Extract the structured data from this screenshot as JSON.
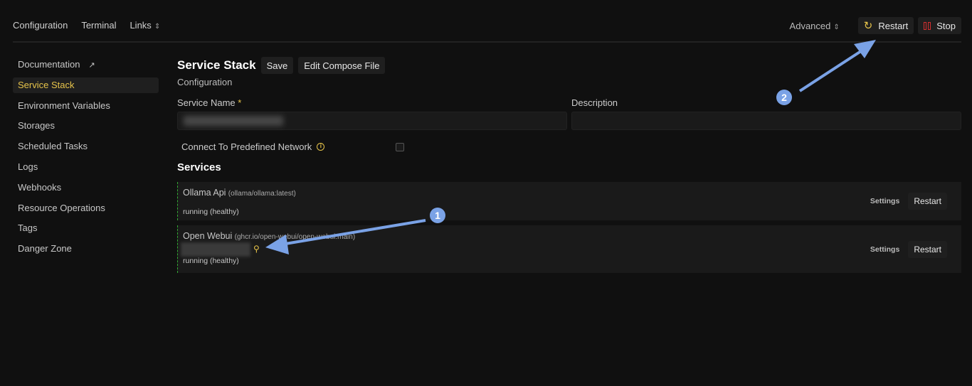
{
  "topnav": {
    "items": [
      "Configuration",
      "Terminal",
      "Links"
    ],
    "advanced": "Advanced",
    "restart": "Restart",
    "stop": "Stop"
  },
  "sidebar": {
    "items": [
      "Documentation",
      "Service Stack",
      "Environment Variables",
      "Storages",
      "Scheduled Tasks",
      "Logs",
      "Webhooks",
      "Resource Operations",
      "Tags",
      "Danger Zone"
    ]
  },
  "main": {
    "title": "Service Stack",
    "save": "Save",
    "edit_compose": "Edit Compose File",
    "subtitle": "Configuration",
    "service_name_label": "Service Name",
    "required": "*",
    "description_label": "Description",
    "network_label": "Connect To Predefined Network",
    "services_heading": "Services",
    "services": [
      {
        "name": "Ollama Api",
        "image": "(ollama/ollama:latest)",
        "status": "running (healthy)",
        "settings": "Settings",
        "restart": "Restart"
      },
      {
        "name": "Open Webui",
        "image": "(ghcr.io/open-webui/open-webui:main)",
        "status": "running (healthy)",
        "settings": "Settings",
        "restart": "Restart"
      }
    ]
  },
  "annotations": [
    "1",
    "2"
  ],
  "colors": {
    "accent": "#e6c34a",
    "stop": "#d32f2f",
    "annotation": "#7aa2e6"
  }
}
